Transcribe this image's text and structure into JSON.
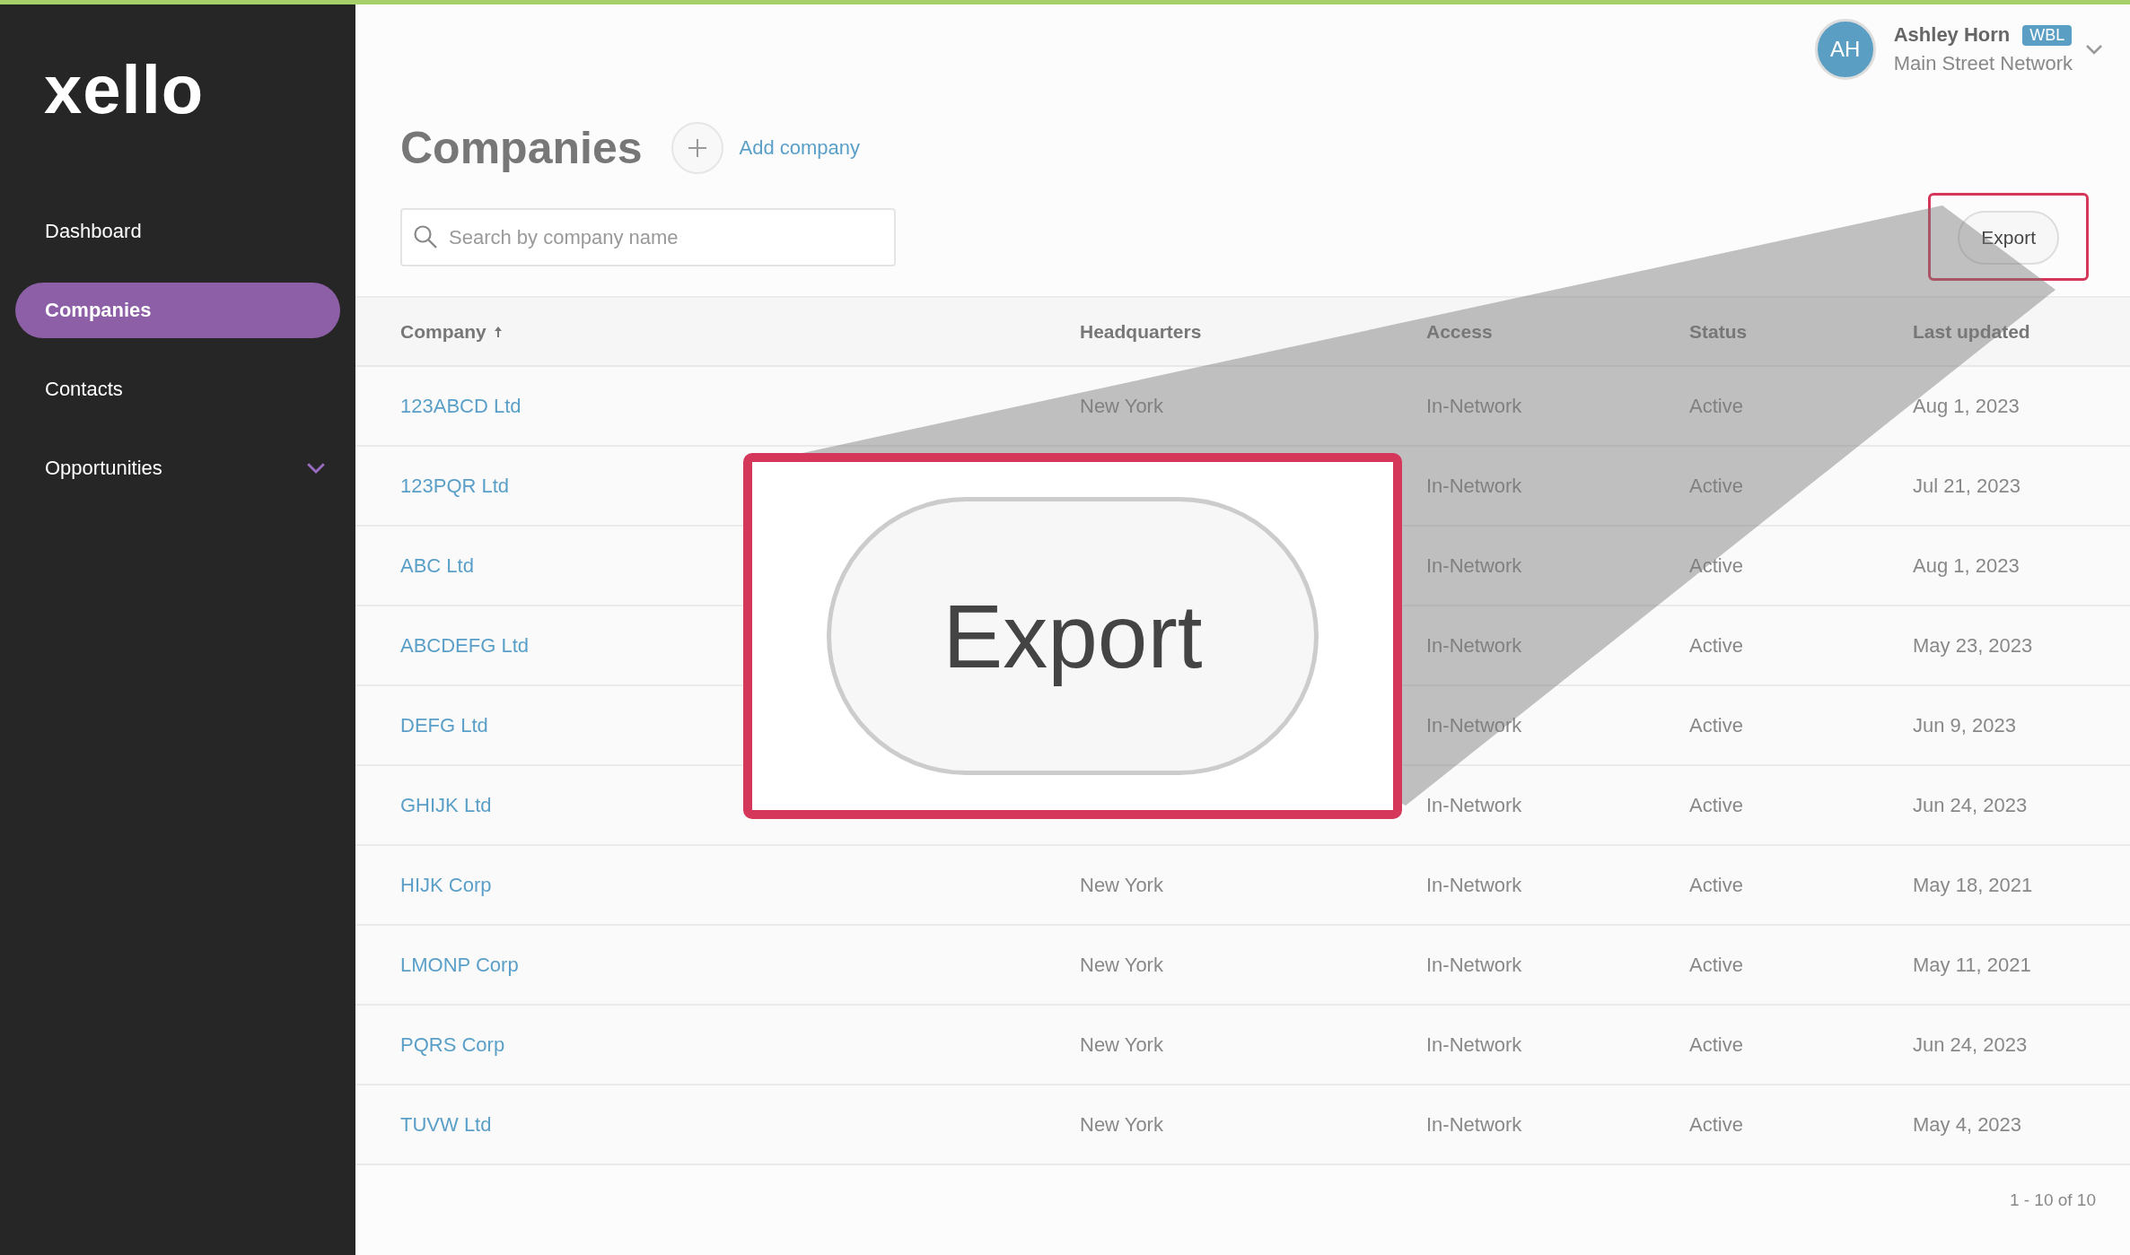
{
  "sidebar": {
    "logo": "xello",
    "items": [
      {
        "label": "Dashboard",
        "selected": false,
        "kind": "link"
      },
      {
        "label": "Companies",
        "selected": true,
        "kind": "link"
      },
      {
        "label": "Contacts",
        "selected": false,
        "kind": "link"
      },
      {
        "label": "Opportunities",
        "selected": false,
        "kind": "group",
        "expanded": false
      }
    ]
  },
  "user": {
    "initials": "AH",
    "name": "Ashley Horn",
    "badge": "WBL",
    "organization": "Main Street Network"
  },
  "page": {
    "title": "Companies",
    "add_label": "Add company"
  },
  "search": {
    "placeholder": "Search by company name"
  },
  "export_button": "Export",
  "table": {
    "columns": [
      {
        "label": "Company",
        "sorted": true
      },
      {
        "label": "Headquarters",
        "sorted": false
      },
      {
        "label": "Access",
        "sorted": false
      },
      {
        "label": "Status",
        "sorted": false
      },
      {
        "label": "Last updated",
        "sorted": false
      }
    ],
    "rows": [
      {
        "company": "123ABCD Ltd",
        "headquarters": "New York",
        "access": "In-Network",
        "status": "Active",
        "updated": "Aug 1, 2023"
      },
      {
        "company": "123PQR Ltd",
        "access": "In-Network",
        "status": "Active",
        "updated": "Jul 21, 2023"
      },
      {
        "company": "ABC Ltd",
        "access": "In-Network",
        "status": "Active",
        "updated": "Aug 1, 2023"
      },
      {
        "company": "ABCDEFG Ltd",
        "access": "In-Network",
        "status": "Active",
        "updated": "May 23, 2023"
      },
      {
        "company": "DEFG Ltd",
        "access": "In-Network",
        "status": "Active",
        "updated": "Jun 9, 2023"
      },
      {
        "company": "GHIJK Ltd",
        "access": "In-Network",
        "status": "Active",
        "updated": "Jun 24, 2023"
      },
      {
        "company": "HIJK Corp",
        "headquarters": "New York",
        "access": "In-Network",
        "status": "Active",
        "updated": "May 18, 2021"
      },
      {
        "company": "LMONP Corp",
        "headquarters": "New York",
        "access": "In-Network",
        "status": "Active",
        "updated": "May 11, 2021"
      },
      {
        "company": "PQRS Corp",
        "headquarters": "New York",
        "access": "In-Network",
        "status": "Active",
        "updated": "Jun 24, 2023"
      },
      {
        "company": "TUVW Ltd",
        "headquarters": "New York",
        "access": "In-Network",
        "status": "Active",
        "updated": "May 4, 2023"
      }
    ]
  },
  "pagination": "1 - 10 of 10",
  "callout": {
    "label": "Export"
  }
}
